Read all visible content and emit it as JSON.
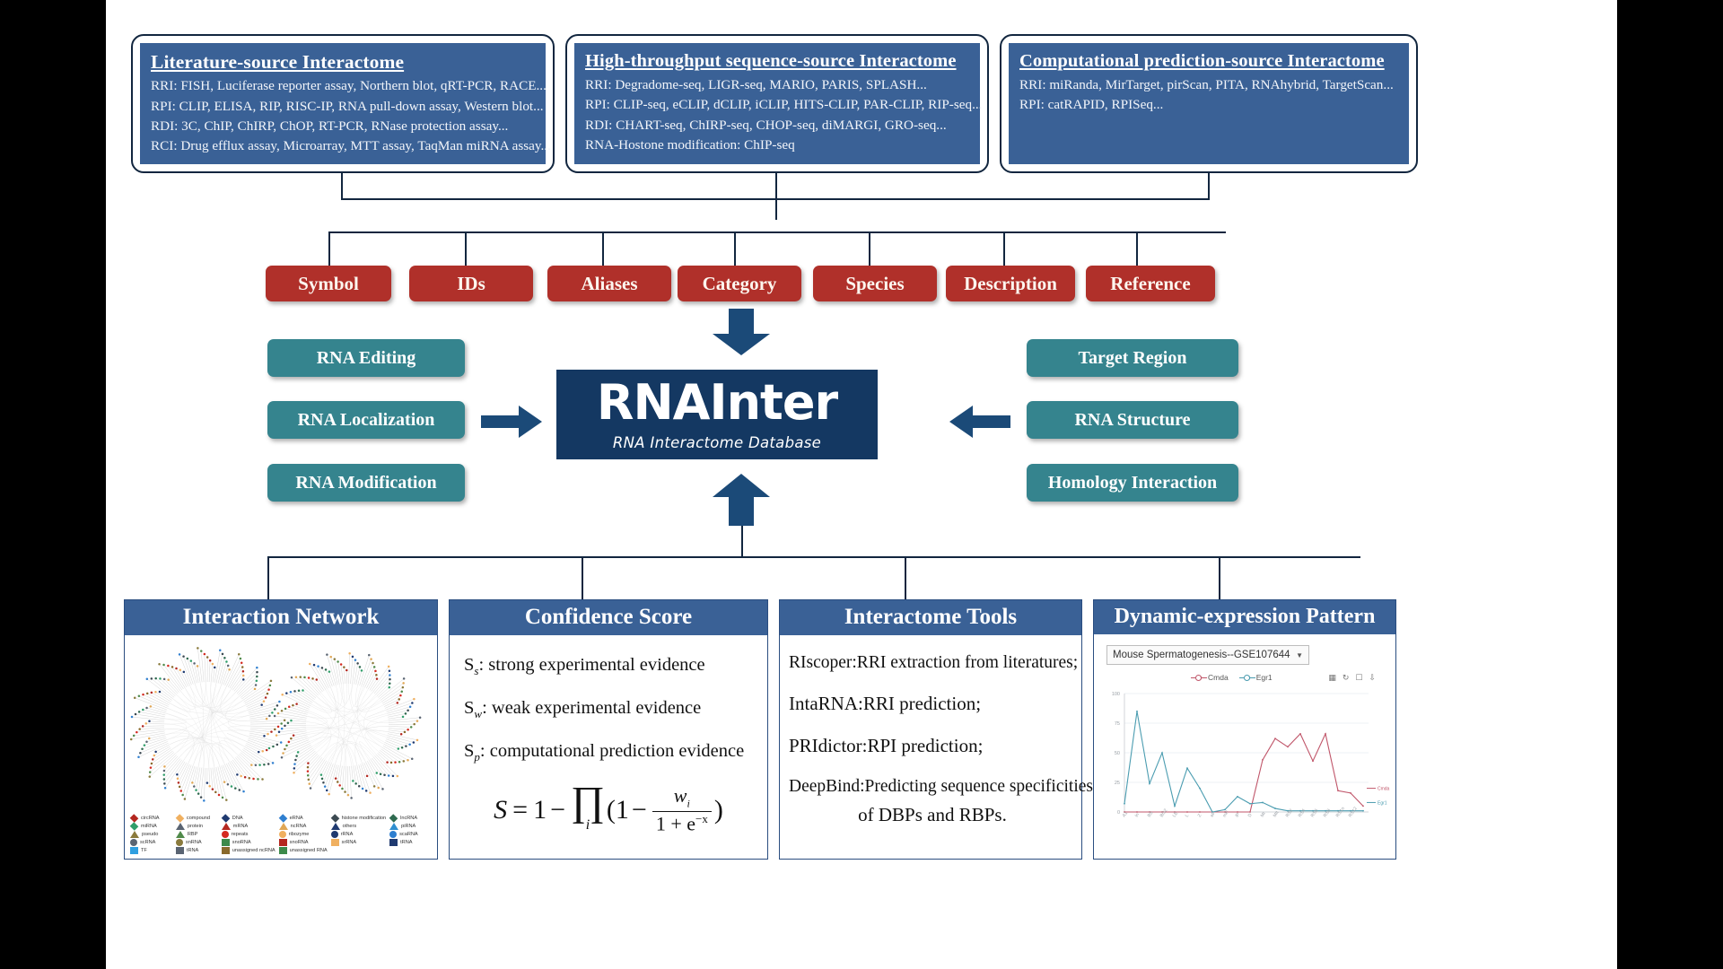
{
  "sources": [
    {
      "title": "Literature-source Interactome",
      "lines": [
        "RRI: FISH, Luciferase reporter assay, Northern blot, qRT-PCR, RACE...",
        "RPI: CLIP, ELISA, RIP, RISC-IP, RNA pull-down assay, Western blot...",
        "RDI: 3C, ChIP, ChIRP, ChOP, RT-PCR, RNase protection assay...",
        "RCI: Drug efflux assay, Microarray, MTT assay, TaqMan miRNA assay..."
      ]
    },
    {
      "title": "High-throughput sequence-source Interactome",
      "lines": [
        "RRI: Degradome-seq, LIGR-seq, MARIO, PARIS, SPLASH...",
        "RPI: CLIP-seq, eCLIP, dCLIP, iCLIP, HITS-CLIP, PAR-CLIP, RIP-seq...",
        "RDI: CHART-seq, ChIRP-seq, CHOP-seq, diMARGI, GRO-seq...",
        "RNA-Hostone modification: ChIP-seq"
      ]
    },
    {
      "title": "Computational prediction-source Interactome",
      "lines": [
        "RRI: miRanda, MirTarget, pirScan, PITA, RNAhybrid, TargetScan...",
        "RPI: catRAPID, RPISeq..."
      ]
    }
  ],
  "attributes": [
    "Symbol",
    "IDs",
    "Aliases",
    "Category",
    "Species",
    "Description",
    "Reference"
  ],
  "left_features": [
    "RNA Editing",
    "RNA Localization",
    "RNA Modification"
  ],
  "right_features": [
    "Target  Region",
    "RNA Structure",
    "Homology Interaction"
  ],
  "logo": {
    "name": "RNAInter",
    "tagline": "RNA Interactome Database"
  },
  "panels": {
    "network": {
      "title": "Interaction Network",
      "legend": [
        {
          "label": "circRNA",
          "shape": "diamond",
          "color": "#b4271f"
        },
        {
          "label": "compound",
          "shape": "diamond",
          "color": "#f0b060"
        },
        {
          "label": "DNA",
          "shape": "diamond",
          "color": "#1f3a70"
        },
        {
          "label": "eRNA",
          "shape": "diamond",
          "color": "#2f7fd0"
        },
        {
          "label": "histone modification",
          "shape": "diamond",
          "color": "#3c4a52"
        },
        {
          "label": "lncRNA",
          "shape": "diamond",
          "color": "#2f6b50"
        },
        {
          "label": "miRNA",
          "shape": "diamond",
          "color": "#2f9e6a"
        },
        {
          "label": "protein",
          "shape": "triangle",
          "color": "#5a6472"
        },
        {
          "label": "mRNA",
          "shape": "triangle",
          "color": "#b4271f"
        },
        {
          "label": "ncRNA",
          "shape": "triangle",
          "color": "#e0a755"
        },
        {
          "label": "others",
          "shape": "triangle",
          "color": "#1f3a70"
        },
        {
          "label": "piRNA",
          "shape": "triangle",
          "color": "#2f8fd0"
        },
        {
          "label": "pseudo",
          "shape": "triangle",
          "color": "#8a7a3c"
        },
        {
          "label": "RBP",
          "shape": "triangle",
          "color": "#4f8a4a"
        },
        {
          "label": "repeats",
          "shape": "circle",
          "color": "#d42a20"
        },
        {
          "label": "ribozyme",
          "shape": "circle",
          "color": "#f0b060"
        },
        {
          "label": "rRNA",
          "shape": "circle",
          "color": "#1f3a70"
        },
        {
          "label": "scaRNA",
          "shape": "circle",
          "color": "#2f7fd0"
        },
        {
          "label": "scRNA",
          "shape": "circle",
          "color": "#5a6472"
        },
        {
          "label": "snRNA",
          "shape": "circle",
          "color": "#8a7a3c"
        },
        {
          "label": "snoRNA",
          "shape": "square",
          "color": "#3c8a4a"
        },
        {
          "label": "snoRNA",
          "shape": "square",
          "color": "#b4271f"
        },
        {
          "label": "srRNA",
          "shape": "square",
          "color": "#f0b060"
        },
        {
          "label": "tRNA",
          "shape": "square",
          "color": "#1f3a70"
        },
        {
          "label": "TF",
          "shape": "square",
          "color": "#2f9fe0"
        },
        {
          "label": "tRNA",
          "shape": "square",
          "color": "#5a6472"
        },
        {
          "label": "unassigned ncRNA",
          "shape": "square",
          "color": "#8a6a2c"
        },
        {
          "label": "unassigned RNA",
          "shape": "square",
          "color": "#3c8a4a"
        }
      ]
    },
    "confidence": {
      "title": "Confidence Score",
      "items": [
        {
          "sym": "S",
          "sub": "s",
          "text": ": strong experimental evidence"
        },
        {
          "sym": "S",
          "sub": "w",
          "text": ": weak experimental evidence"
        },
        {
          "sym": "S",
          "sub": "p",
          "text": ": computational prediction evidence"
        }
      ],
      "formula": {
        "lhs": "S",
        "eq": "=",
        "one": "1",
        "minus": "−",
        "prod": "∏",
        "prod_sub": "i",
        "open": "(1",
        "num": "w",
        "num_sub": "i",
        "den": "1 + e",
        "den_sup": "−x",
        "close": ")"
      }
    },
    "tools": {
      "title": "Interactome Tools",
      "lines": [
        "RIscoper:RRI extraction from literatures;",
        "IntaRNA:RRI prediction;",
        "PRIdictor:RPI prediction;",
        "DeepBind:Predicting sequence specificities",
        "of DBPs and RBPs."
      ]
    },
    "dynamic": {
      "title": "Dynamic-expression Pattern",
      "dataset_select": "Mouse Spermatogenesis--GSE107644",
      "caret": "▼",
      "icons": [
        "chart-icon",
        "refresh-icon",
        "image-icon",
        "download-icon"
      ]
    }
  },
  "chart_data": {
    "type": "line",
    "title": "Mouse Spermatogenesis--GSE107644",
    "xlabel": "",
    "ylabel": "",
    "ylim": [
      0,
      100
    ],
    "yticks": [
      0,
      25,
      50,
      75,
      100
    ],
    "grid": true,
    "legend_position": "top",
    "x": [
      "A1",
      "In",
      "BS",
      "BG2",
      "LE",
      "L",
      "Z",
      "eP",
      "mP",
      "lP",
      "D",
      "MI",
      "MII",
      "RS2",
      "RS4",
      "RS6",
      "RS8",
      "RS1o",
      "RS12"
    ],
    "series": [
      {
        "name": "Cmda",
        "color": "#c0566a",
        "values": [
          0,
          0,
          0,
          0,
          0,
          0,
          0,
          0,
          0,
          0,
          0,
          44,
          62,
          55,
          66,
          43,
          66,
          18,
          16,
          5
        ]
      },
      {
        "name": "Egr1",
        "color": "#4a9cb0",
        "values": [
          7,
          85,
          24,
          50,
          5,
          37,
          20,
          0,
          2,
          13,
          7,
          8,
          3,
          1,
          1,
          1,
          1,
          1,
          1,
          1
        ]
      }
    ],
    "end_labels": [
      {
        "text": "Cmda",
        "color": "#c0566a"
      },
      {
        "text": "Egr1",
        "color": "#4a9cb0"
      }
    ]
  },
  "colors": {
    "brand_dark": "#143862",
    "source_blue": "#3a6196",
    "attribute_red": "#b0302a",
    "feature_teal": "#35848e",
    "line": "#12263f"
  }
}
